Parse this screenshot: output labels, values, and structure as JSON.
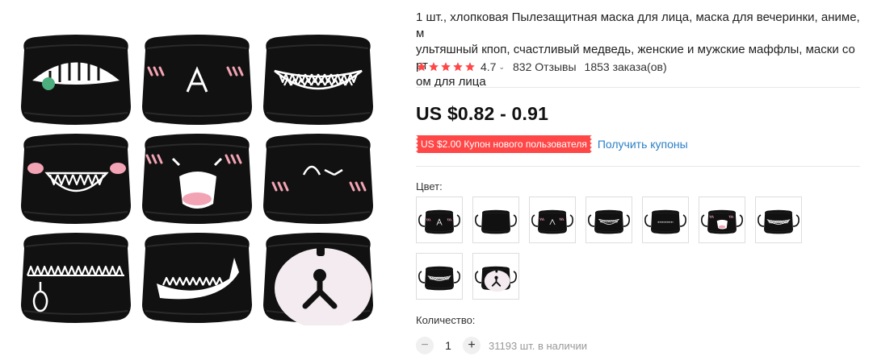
{
  "product": {
    "title": "1 шт., хлопковая Пылезащитная маска для лица, маска для вечеринки, аниме, мультяшный кпоп, счастливый медведь, женские и мужские маффлы, маски со ртом для лица",
    "title_lines": [
      "1 шт., хлопковая Пылезащитная маска для лица, маска для вечеринки, аниме, м",
      "ультяшный кпоп, счастливый медведь, женские и мужские маффлы, маски со рт",
      "ом для лица"
    ]
  },
  "rating": {
    "score": "4.7",
    "stars": 5,
    "caret": "⌄",
    "reviews": "832 Отзывы",
    "orders": "1853 заказа(ов)"
  },
  "price": {
    "value": "US $0.82 - 0.91"
  },
  "coupon": {
    "badge": "US $2.00 Купон нового пользователя",
    "link": "Получить купоны"
  },
  "color": {
    "label": "Цвет:",
    "options": [
      "blush-a",
      "teeth-sharp",
      "blush-a-wide",
      "teeth-photo",
      "stitch-mouth",
      "fang-photo",
      "teeth-smile",
      "teeth-grin",
      "bear-face"
    ]
  },
  "quantity": {
    "label": "Количество:",
    "minus": "−",
    "plus": "+",
    "value": "1",
    "stock": "31193 шт. в наличии"
  },
  "gallery": {
    "masks": [
      "teeth-green-eye",
      "blush-a",
      "teeth-grin",
      "pink-dot-grin",
      "blush-fang",
      "blush-squint",
      "zipper-teeth",
      "fang-wave",
      "bear-face"
    ]
  },
  "colors": {
    "accent": "#ff4747",
    "link": "#2a7fc6",
    "star": "#ff4747",
    "mask": "#111111",
    "pink": "#f2a3b4"
  }
}
